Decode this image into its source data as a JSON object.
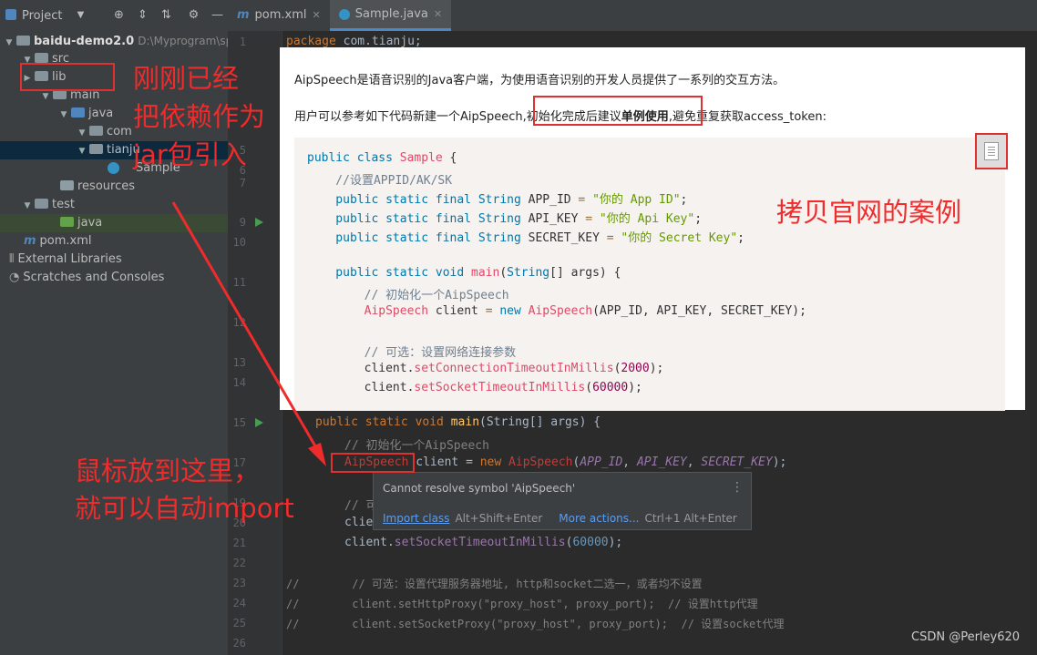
{
  "project_panel": {
    "title": "Project",
    "tree": [
      {
        "label": "baidu-demo2.0",
        "extra": "D:\\Myprogram\\sprin"
      },
      {
        "label": "src"
      },
      {
        "label": "lib"
      },
      {
        "label": "main"
      },
      {
        "label": "java"
      },
      {
        "label": "com"
      },
      {
        "label": "tianju"
      },
      {
        "label": "Sample"
      },
      {
        "label": "resources"
      },
      {
        "label": "test"
      },
      {
        "label": "java"
      },
      {
        "label": "pom.xml"
      },
      {
        "label": "External Libraries"
      },
      {
        "label": "Scratches and Consoles"
      }
    ]
  },
  "editor": {
    "tabs": [
      {
        "label": "pom.xml"
      },
      {
        "label": "Sample.java"
      }
    ],
    "line_numbers": [
      "1",
      "5",
      "6",
      "7",
      "8",
      "9",
      "10",
      "11",
      "12",
      "13",
      "14",
      "15",
      "17",
      "19",
      "20",
      "21",
      "22",
      "23",
      "24",
      "25",
      "26"
    ],
    "lines": {
      "l1_kw": "package",
      "l1_rest": " com.tianju;",
      "l15_kw": "public static void ",
      "l15_fn": "main",
      "l15_rest": "(String[] args) {",
      "l16_cm": "// 初始化一个AipSpeech",
      "l17_err1": "AipSpeech",
      "l17_a": " client = ",
      "l17_kw": "new ",
      "l17_err2": "AipSpeech",
      "l17_b": "(",
      "l17_f1": "APP_ID",
      "l17_c": ", ",
      "l17_f2": "API_KEY",
      "l17_d": ", ",
      "l17_f3": "SECRET_KEY",
      "l17_e": ");",
      "l19_cm": "// 可",
      "l20_a": "clie",
      "l21_a": "client.",
      "l21_fn": "setSocketTimeoutInMillis",
      "l21_b": "(",
      "l21_num": "60000",
      "l21_c": ");",
      "l23": "//        // 可选：设置代理服务器地址, http和socket二选一，或者均不设置",
      "l24": "//        client.setHttpProxy(\"proxy_host\", proxy_port);  // 设置http代理",
      "l25": "//        client.setSocketProxy(\"proxy_host\", proxy_port);  // 设置socket代理"
    }
  },
  "doc_popup": {
    "para1": "AipSpeech是语音识别的Java客户端，为使用语音识别的开发人员提供了一系列的交互方法。",
    "para2_a": "用户可以参考如下代码新建一个AipSpeech,",
    "para2_b": "初始化完成后建议",
    "para2_bold": "单例使用",
    "para2_c": ",避免重复获取access_token:",
    "code": {
      "c1_kw": "public class ",
      "c1_cls": "Sample",
      "c1_rest": " {",
      "c2": "    //设置APPID/AK/SK",
      "c3_kw": "    public static final String ",
      "c3_name": "APP_ID",
      "c3_eq": " = ",
      "c3_str": "\"你的 App ID\"",
      "c3_end": ";",
      "c4_kw": "    public static final String ",
      "c4_name": "API_KEY",
      "c4_eq": " = ",
      "c4_str": "\"你的 Api Key\"",
      "c4_end": ";",
      "c5_kw": "    public static final String ",
      "c5_name": "SECRET_KEY",
      "c5_eq": " = ",
      "c5_str": "\"你的 Secret Key\"",
      "c5_end": ";",
      "c6_kw": "    public static void ",
      "c6_fn": "main",
      "c6_a": "(",
      "c6_type": "String",
      "c6_b": "[] args) {",
      "c7": "        // 初始化一个AipSpeech",
      "c8_cls": "        AipSpeech",
      "c8_a": " client ",
      "c8_eq": "= ",
      "c8_kw": "new ",
      "c8_cls2": "AipSpeech",
      "c8_b": "(APP_ID, API_KEY, SECRET_KEY);",
      "c9": "        // 可选：设置网络连接参数",
      "c10_a": "        client.",
      "c10_fn": "setConnectionTimeoutInMillis",
      "c10_b": "(",
      "c10_num": "2000",
      "c10_c": ");",
      "c11_a": "        client.",
      "c11_fn": "setSocketTimeoutInMillis",
      "c11_b": "(",
      "c11_num": "60000",
      "c11_c": ");"
    }
  },
  "error_popup": {
    "message": "Cannot resolve symbol 'AipSpeech'",
    "action_primary": "Import class",
    "action_primary_hint": "Alt+Shift+Enter",
    "action_more": "More actions...",
    "action_more_hint": "Ctrl+1 Alt+Enter"
  },
  "annotations": {
    "lib_note_1": "刚刚已经",
    "lib_note_2": "把依赖作为",
    "lib_note_3": "jar包引入",
    "copy_note": "拷贝官网的案例",
    "hover_note_1": "鼠标放到这里，",
    "hover_note_2": "就可以自动import"
  },
  "watermark": "CSDN @Perley620",
  "colors": {
    "annotation_red": "#f02b2b",
    "error_red": "#bc3f3c",
    "link_blue": "#589df6"
  }
}
